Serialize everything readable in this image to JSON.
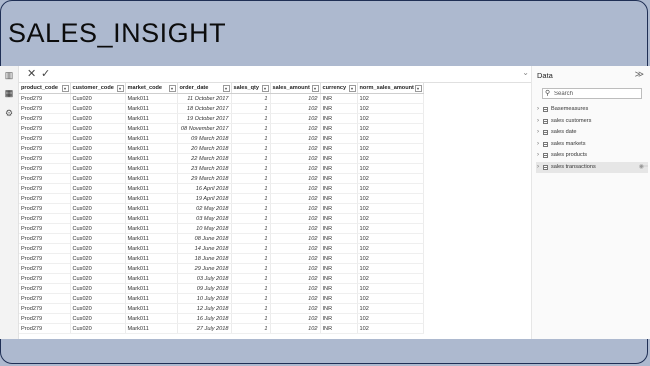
{
  "slide": {
    "title": "SALES_INSIGHT"
  },
  "rail": {
    "icons": [
      {
        "name": "report-view-icon",
        "glyph": "▥"
      },
      {
        "name": "table-view-icon",
        "glyph": "▦"
      },
      {
        "name": "model-view-icon",
        "glyph": "⚙"
      }
    ]
  },
  "formula_bar": {
    "cancel_glyph": "✕",
    "commit_glyph": "✓",
    "collapse_glyph": "⌄"
  },
  "grid": {
    "columns": [
      "product_code",
      "customer_code",
      "market_code",
      "order_date",
      "sales_qty",
      "sales_amount",
      "currency",
      "norm_sales_amount"
    ],
    "rows": [
      [
        "Prod279",
        "Cus020",
        "Mark011",
        "11 October 2017",
        "1",
        "102",
        "INR",
        "102"
      ],
      [
        "Prod279",
        "Cus020",
        "Mark011",
        "18 October 2017",
        "1",
        "102",
        "INR",
        "102"
      ],
      [
        "Prod279",
        "Cus020",
        "Mark011",
        "19 October 2017",
        "1",
        "102",
        "INR",
        "102"
      ],
      [
        "Prod279",
        "Cus020",
        "Mark011",
        "08 November 2017",
        "1",
        "102",
        "INR",
        "102"
      ],
      [
        "Prod279",
        "Cus020",
        "Mark011",
        "09 March 2018",
        "1",
        "102",
        "INR",
        "102"
      ],
      [
        "Prod279",
        "Cus020",
        "Mark011",
        "20 March 2018",
        "1",
        "102",
        "INR",
        "102"
      ],
      [
        "Prod279",
        "Cus020",
        "Mark011",
        "22 March 2018",
        "1",
        "102",
        "INR",
        "102"
      ],
      [
        "Prod279",
        "Cus020",
        "Mark011",
        "23 March 2018",
        "1",
        "102",
        "INR",
        "102"
      ],
      [
        "Prod279",
        "Cus020",
        "Mark011",
        "29 March 2018",
        "1",
        "102",
        "INR",
        "102"
      ],
      [
        "Prod279",
        "Cus020",
        "Mark011",
        "16 April 2018",
        "1",
        "102",
        "INR",
        "102"
      ],
      [
        "Prod279",
        "Cus020",
        "Mark011",
        "19 April 2018",
        "1",
        "102",
        "INR",
        "102"
      ],
      [
        "Prod279",
        "Cus020",
        "Mark011",
        "02 May 2018",
        "1",
        "102",
        "INR",
        "102"
      ],
      [
        "Prod279",
        "Cus020",
        "Mark011",
        "03 May 2018",
        "1",
        "102",
        "INR",
        "102"
      ],
      [
        "Prod279",
        "Cus020",
        "Mark011",
        "10 May 2018",
        "1",
        "102",
        "INR",
        "102"
      ],
      [
        "Prod279",
        "Cus020",
        "Mark011",
        "08 June 2018",
        "1",
        "102",
        "INR",
        "102"
      ],
      [
        "Prod279",
        "Cus020",
        "Mark011",
        "14 June 2018",
        "1",
        "102",
        "INR",
        "102"
      ],
      [
        "Prod279",
        "Cus020",
        "Mark011",
        "18 June 2018",
        "1",
        "102",
        "INR",
        "102"
      ],
      [
        "Prod279",
        "Cus020",
        "Mark011",
        "29 June 2018",
        "1",
        "102",
        "INR",
        "102"
      ],
      [
        "Prod279",
        "Cus020",
        "Mark011",
        "03 July 2018",
        "1",
        "102",
        "INR",
        "102"
      ],
      [
        "Prod279",
        "Cus020",
        "Mark011",
        "09 July 2018",
        "1",
        "102",
        "INR",
        "102"
      ],
      [
        "Prod279",
        "Cus020",
        "Mark011",
        "10 July 2018",
        "1",
        "102",
        "INR",
        "102"
      ],
      [
        "Prod279",
        "Cus020",
        "Mark011",
        "12 July 2018",
        "1",
        "102",
        "INR",
        "102"
      ],
      [
        "Prod279",
        "Cus020",
        "Mark011",
        "16 July 2018",
        "1",
        "102",
        "INR",
        "102"
      ],
      [
        "Prod279",
        "Cus020",
        "Mark011",
        "27 July 2018",
        "1",
        "102",
        "INR",
        "102"
      ]
    ]
  },
  "data_pane": {
    "title": "Data",
    "expand_glyph": "≫",
    "search": {
      "placeholder": "Search",
      "value": ""
    },
    "tables": [
      {
        "name": "Basemeasures",
        "selected": false
      },
      {
        "name": "sales customers",
        "selected": false
      },
      {
        "name": "sales date",
        "selected": false
      },
      {
        "name": "sales markets",
        "selected": false
      },
      {
        "name": "sales products",
        "selected": false
      },
      {
        "name": "sales transactions",
        "selected": true
      }
    ]
  },
  "colors": {
    "slide_background": "#adb9cf",
    "frame_border": "#1f2f55",
    "selected_row": "#e6e6e6"
  }
}
